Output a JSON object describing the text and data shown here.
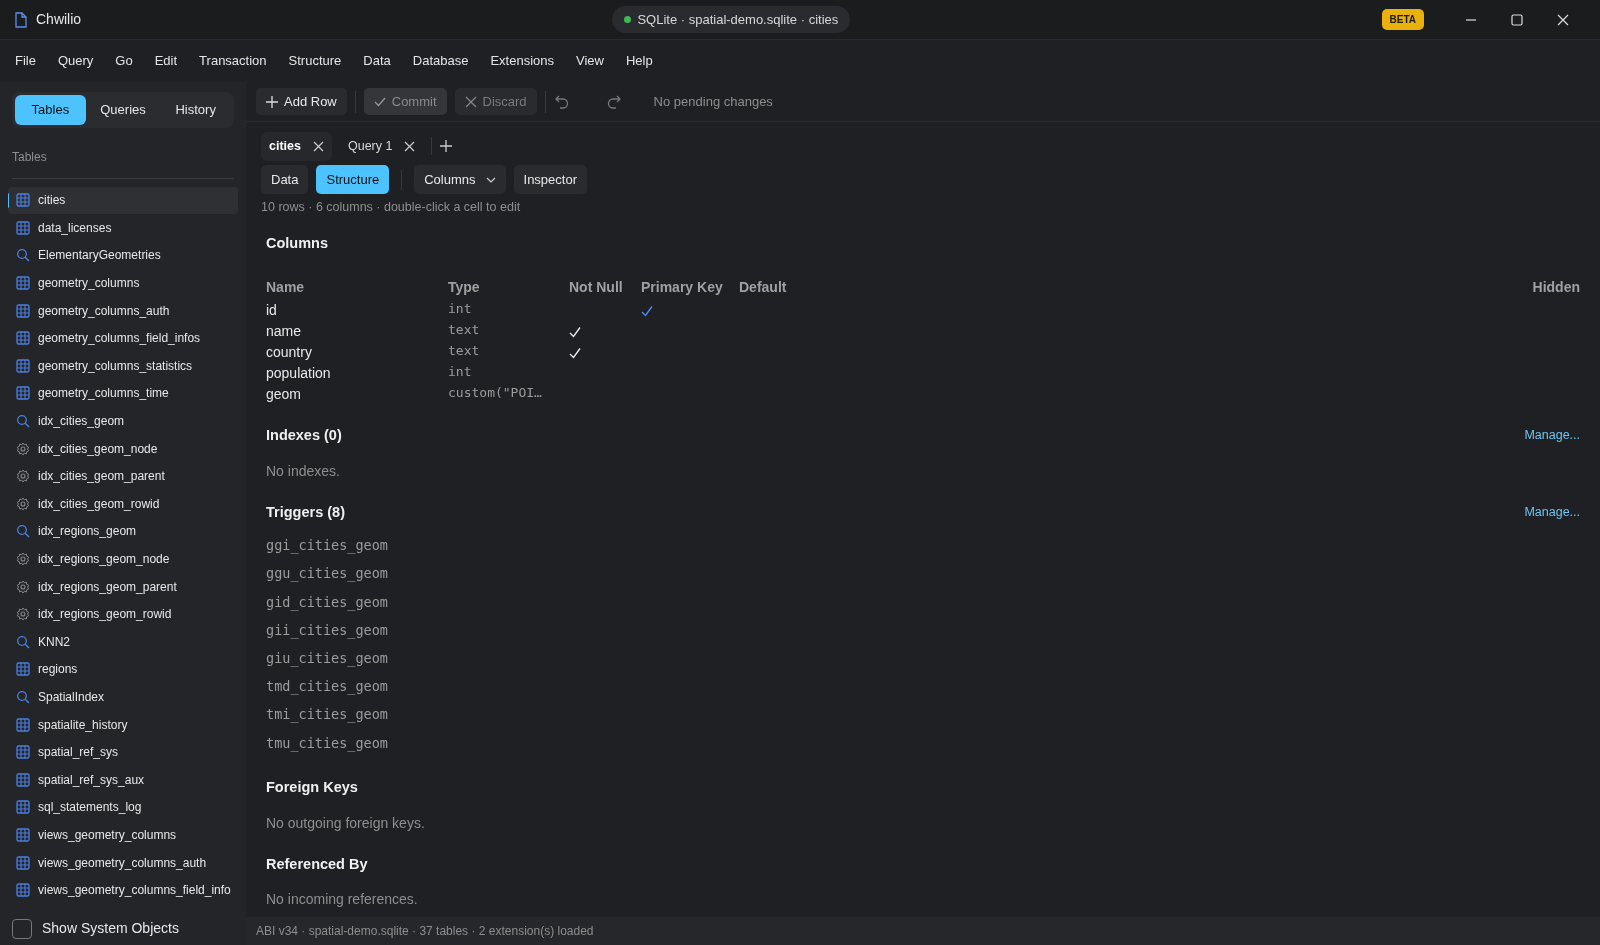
{
  "window": {
    "title": "Chwilio",
    "connection": {
      "label": "SQLite · spatial-demo.sqlite · cities",
      "connected": true
    },
    "badge": "BETA"
  },
  "menu": [
    "File",
    "Query",
    "Go",
    "Edit",
    "Transaction",
    "Structure",
    "Data",
    "Database",
    "Extensions",
    "View",
    "Help"
  ],
  "sidebar": {
    "tabs": [
      {
        "label": "Tables",
        "selected": true
      },
      {
        "label": "Queries",
        "selected": false
      },
      {
        "label": "History",
        "selected": false
      }
    ],
    "heading": "Tables",
    "items": [
      {
        "label": "cities",
        "kind": "table",
        "selected": true
      },
      {
        "label": "data_licenses",
        "kind": "table",
        "selected": false
      },
      {
        "label": "ElementaryGeometries",
        "kind": "view",
        "selected": false
      },
      {
        "label": "geometry_columns",
        "kind": "table",
        "selected": false
      },
      {
        "label": "geometry_columns_auth",
        "kind": "table",
        "selected": false
      },
      {
        "label": "geometry_columns_field_infos",
        "kind": "table",
        "selected": false
      },
      {
        "label": "geometry_columns_statistics",
        "kind": "table",
        "selected": false
      },
      {
        "label": "geometry_columns_time",
        "kind": "table",
        "selected": false
      },
      {
        "label": "idx_cities_geom",
        "kind": "view",
        "selected": false
      },
      {
        "label": "idx_cities_geom_node",
        "kind": "system",
        "selected": false
      },
      {
        "label": "idx_cities_geom_parent",
        "kind": "system",
        "selected": false
      },
      {
        "label": "idx_cities_geom_rowid",
        "kind": "system",
        "selected": false
      },
      {
        "label": "idx_regions_geom",
        "kind": "view",
        "selected": false
      },
      {
        "label": "idx_regions_geom_node",
        "kind": "system",
        "selected": false
      },
      {
        "label": "idx_regions_geom_parent",
        "kind": "system",
        "selected": false
      },
      {
        "label": "idx_regions_geom_rowid",
        "kind": "system",
        "selected": false
      },
      {
        "label": "KNN2",
        "kind": "view",
        "selected": false
      },
      {
        "label": "regions",
        "kind": "table",
        "selected": false
      },
      {
        "label": "SpatialIndex",
        "kind": "view",
        "selected": false
      },
      {
        "label": "spatialite_history",
        "kind": "table",
        "selected": false
      },
      {
        "label": "spatial_ref_sys",
        "kind": "table",
        "selected": false
      },
      {
        "label": "spatial_ref_sys_aux",
        "kind": "table",
        "selected": false
      },
      {
        "label": "sql_statements_log",
        "kind": "table",
        "selected": false
      },
      {
        "label": "views_geometry_columns",
        "kind": "table",
        "selected": false
      },
      {
        "label": "views_geometry_columns_auth",
        "kind": "table",
        "selected": false
      },
      {
        "label": "views_geometry_columns_field_info",
        "kind": "table",
        "selected": false
      }
    ],
    "show_system": {
      "label": "Show System Objects",
      "checked": false
    }
  },
  "toolbar": {
    "buttons": [
      {
        "label": "Add Row",
        "kind": "add",
        "disabled": false
      },
      {
        "label": "Commit",
        "kind": "commit",
        "disabled": true
      },
      {
        "label": "Discard",
        "kind": "discard",
        "disabled": true
      }
    ],
    "status": "No pending changes"
  },
  "tabs": [
    {
      "label": "cities",
      "selected": true
    },
    {
      "label": "Query 1",
      "selected": false
    }
  ],
  "view_tabs": [
    {
      "label": "Data",
      "selected": false,
      "kind": "tab"
    },
    {
      "label": "Structure",
      "selected": true,
      "kind": "tab"
    },
    {
      "label": "Columns",
      "selected": false,
      "kind": "dropdown"
    },
    {
      "label": "Inspector",
      "selected": false,
      "kind": "tab"
    }
  ],
  "info": "10 rows · 6 columns · double-click a cell to edit",
  "columns_section": {
    "title": "Columns",
    "headers": [
      "Name",
      "Type",
      "Not Null",
      "Primary Key",
      "Default",
      "Hidden"
    ],
    "rows": [
      {
        "name": "id",
        "type": "int",
        "not_null": false,
        "primary_key": true
      },
      {
        "name": "name",
        "type": "text",
        "not_null": true,
        "primary_key": false
      },
      {
        "name": "country",
        "type": "text",
        "not_null": true,
        "primary_key": false
      },
      {
        "name": "population",
        "type": "int",
        "not_null": false,
        "primary_key": false
      },
      {
        "name": "geom",
        "type": "custom(\"POI…",
        "not_null": false,
        "primary_key": false
      }
    ]
  },
  "indexes": {
    "title": "Indexes (0)",
    "action": "Manage...",
    "empty": "No indexes."
  },
  "triggers": {
    "title": "Triggers (8)",
    "action": "Manage...",
    "items": [
      "ggi_cities_geom",
      "ggu_cities_geom",
      "gid_cities_geom",
      "gii_cities_geom",
      "giu_cities_geom",
      "tmd_cities_geom",
      "tmi_cities_geom",
      "tmu_cities_geom"
    ]
  },
  "foreign_keys": {
    "title": "Foreign Keys",
    "empty": "No outgoing foreign keys."
  },
  "referenced_by": {
    "title": "Referenced By",
    "empty": "No incoming references."
  },
  "status_bar": "ABI v34 · spatial-demo.sqlite · 37 tables · 2 extension(s) loaded"
}
